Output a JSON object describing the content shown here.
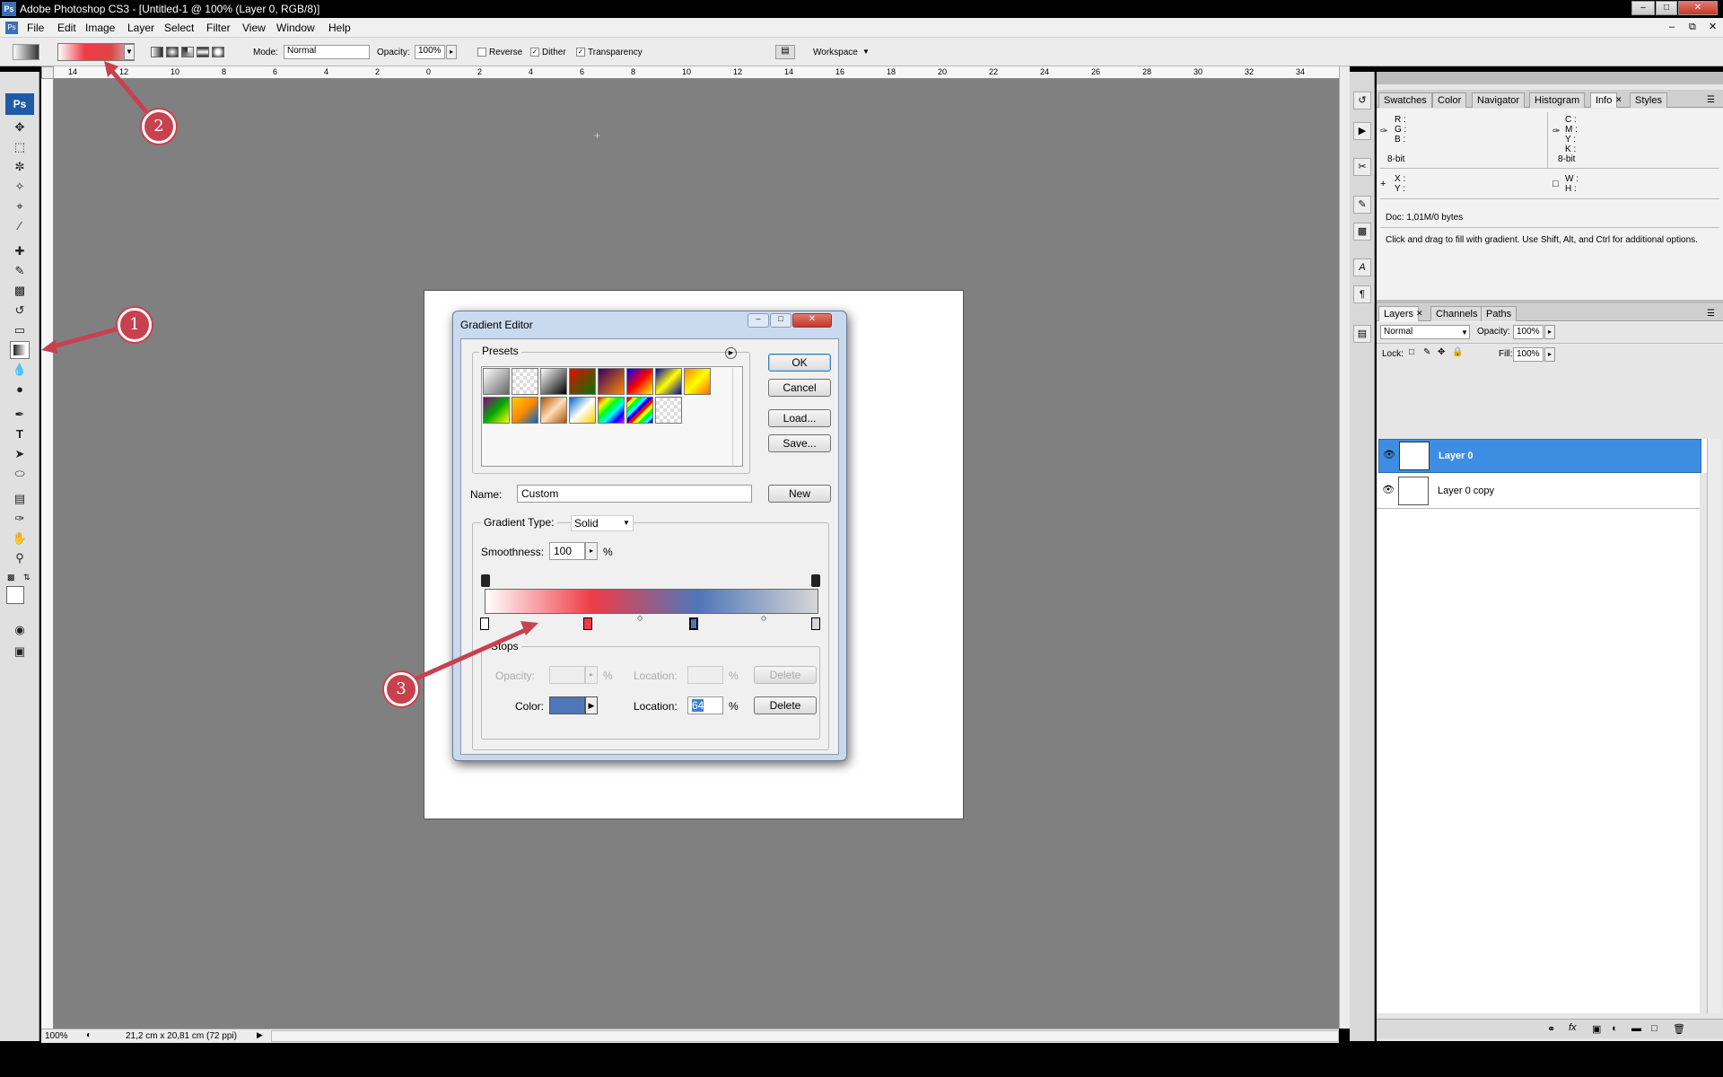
{
  "window": {
    "app_icon": "Ps",
    "title": "Adobe Photoshop CS3 - [Untitled-1 @ 100% (Layer 0, RGB/8)]"
  },
  "menu": [
    "File",
    "Edit",
    "Image",
    "Layer",
    "Select",
    "Filter",
    "View",
    "Window",
    "Help"
  ],
  "options_bar": {
    "mode_label": "Mode:",
    "mode_value": "Normal",
    "opacity_label": "Opacity:",
    "opacity_value": "100%",
    "reverse_label": "Reverse",
    "dither_label": "Dither",
    "transparency_label": "Transparency",
    "workspace_label": "Workspace",
    "reverse_checked": false,
    "dither_checked": true,
    "transparency_checked": true
  },
  "toolbox": {
    "logo": "Ps",
    "tools": [
      "move-tool",
      "marquee-tool",
      "lasso-tool",
      "magic-wand-tool",
      "crop-tool",
      "slice-tool",
      "healing-brush-tool",
      "brush-tool",
      "clone-stamp-tool",
      "history-brush-tool",
      "eraser-tool",
      "gradient-tool",
      "blur-tool",
      "dodge-tool",
      "pen-tool",
      "type-tool",
      "path-selection-tool",
      "shape-tool",
      "notes-tool",
      "eyedropper-tool",
      "hand-tool",
      "zoom-tool"
    ]
  },
  "rulers": {
    "top_ticks": [
      "14",
      "12",
      "10",
      "8",
      "6",
      "4",
      "2",
      "0",
      "2",
      "4",
      "6",
      "8",
      "10",
      "12",
      "14",
      "16",
      "18",
      "20",
      "22",
      "24",
      "26",
      "28",
      "30",
      "32",
      "34"
    ]
  },
  "status_bar": {
    "zoom": "100%",
    "doc_size": "21,2 cm x 20,81 cm (72 ppi)"
  },
  "info_panel": {
    "tabs": [
      "Swatches",
      "Color",
      "Navigator",
      "Histogram",
      "Info",
      "Styles"
    ],
    "active_tab": "Info",
    "rgb_labels": [
      "R :",
      "G :",
      "B :"
    ],
    "cmyk_labels": [
      "C :",
      "M :",
      "Y :",
      "K :"
    ],
    "bit_left": "8-bit",
    "bit_right": "8-bit",
    "xy_labels": [
      "X :",
      "Y :"
    ],
    "wh_labels": [
      "W :",
      "H :"
    ],
    "doc": "Doc: 1,01M/0 bytes",
    "hint": "Click and drag to fill with gradient.  Use Shift, Alt, and Ctrl for additional options."
  },
  "layers_panel": {
    "tabs": [
      "Layers",
      "Channels",
      "Paths"
    ],
    "active_tab": "Layers",
    "blend_mode": "Normal",
    "opacity_label": "Opacity:",
    "opacity_value": "100%",
    "lock_label": "Lock:",
    "fill_label": "Fill:",
    "fill_value": "100%",
    "layers": [
      {
        "name": "Layer 0",
        "selected": true
      },
      {
        "name": "Layer 0 copy",
        "selected": false
      }
    ]
  },
  "gradient_editor": {
    "title": "Gradient Editor",
    "presets_label": "Presets",
    "buttons": {
      "ok": "OK",
      "cancel": "Cancel",
      "load": "Load...",
      "save": "Save...",
      "new": "New"
    },
    "name_label": "Name:",
    "name_value": "Custom",
    "gradient_type_label": "Gradient Type:",
    "gradient_type_value": "Solid",
    "smoothness_label": "Smoothness:",
    "smoothness_value": "100",
    "percent": "%",
    "stops_label": "Stops",
    "opacity_label": "Opacity:",
    "location_label": "Location:",
    "delete_label": "Delete",
    "color_label": "Color:",
    "color_location_value": "64",
    "stop_color": "#4f76b8",
    "gradient_colors": [
      "#ffffff",
      "#ef3b46",
      "#4f76b8",
      "#d6d6d6"
    ],
    "color_stop_locations_pct": [
      0,
      32,
      64,
      100
    ]
  },
  "annotations": {
    "callouts": [
      "1",
      "2",
      "3"
    ],
    "color": "#c8414f"
  }
}
